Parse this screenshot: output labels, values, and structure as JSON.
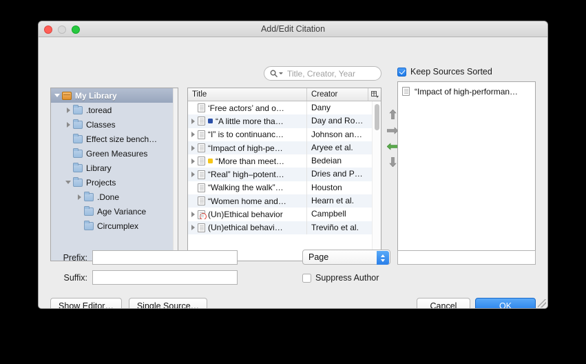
{
  "window": {
    "title": "Add/Edit Citation",
    "traffic_lights": [
      "close-button",
      "minimize-button",
      "zoom-button"
    ]
  },
  "search": {
    "placeholder": "Title, Creator, Year",
    "value": "",
    "icon": "search-icon"
  },
  "keep_sources_sorted": {
    "label": "Keep Sources Sorted",
    "checked": true
  },
  "collections": {
    "rows": [
      {
        "label": "My Library",
        "indent": 0,
        "icon": "library-icon",
        "twisty": "down",
        "selected": true
      },
      {
        "label": ".toread",
        "indent": 1,
        "icon": "folder-icon",
        "twisty": "right",
        "selected": false
      },
      {
        "label": "Classes",
        "indent": 1,
        "icon": "folder-icon",
        "twisty": "right",
        "selected": false
      },
      {
        "label": "Effect size bench…",
        "indent": 1,
        "icon": "folder-icon",
        "twisty": "none",
        "selected": false
      },
      {
        "label": "Green Measures",
        "indent": 1,
        "icon": "folder-icon",
        "twisty": "none",
        "selected": false
      },
      {
        "label": "Library",
        "indent": 1,
        "icon": "folder-icon",
        "twisty": "none",
        "selected": false
      },
      {
        "label": "Projects",
        "indent": 1,
        "icon": "folder-icon",
        "twisty": "down",
        "selected": false
      },
      {
        "label": ".Done",
        "indent": 2,
        "icon": "folder-icon",
        "twisty": "right",
        "selected": false
      },
      {
        "label": "Age Variance",
        "indent": 2,
        "icon": "folder-icon",
        "twisty": "none",
        "selected": false
      },
      {
        "label": "Circumplex",
        "indent": 2,
        "icon": "folder-icon",
        "twisty": "none",
        "selected": false
      }
    ]
  },
  "items": {
    "columns": {
      "title": "Title",
      "creator": "Creator",
      "options_icon": "column-options-icon"
    },
    "rows": [
      {
        "title": "‘Free actors’ and o…",
        "creator": "Dany",
        "twisty": false,
        "dot": "",
        "icon": "document-icon"
      },
      {
        "title": "“A little more tha…",
        "creator": "Day and Ro…",
        "twisty": true,
        "dot": "blue",
        "icon": "document-icon"
      },
      {
        "title": "“I” is to continuanc…",
        "creator": "Johnson an…",
        "twisty": true,
        "dot": "",
        "icon": "document-icon"
      },
      {
        "title": "“Impact of high-pe…",
        "creator": "Aryee et al.",
        "twisty": true,
        "dot": "",
        "icon": "document-icon"
      },
      {
        "title": "“More than meet…",
        "creator": "Bedeian",
        "twisty": true,
        "dot": "yellow",
        "icon": "document-icon"
      },
      {
        "title": "“Real” high–potent…",
        "creator": "Dries and P…",
        "twisty": true,
        "dot": "",
        "icon": "document-icon"
      },
      {
        "title": "“Walking the walk”…",
        "creator": "Houston",
        "twisty": false,
        "dot": "",
        "icon": "document-icon"
      },
      {
        "title": "“Women home and…",
        "creator": "Hearn et al.",
        "twisty": false,
        "dot": "",
        "icon": "document-icon"
      },
      {
        "title": "(Un)Ethical behavior",
        "creator": "Campbell",
        "twisty": true,
        "dot": "",
        "icon": "document-attachment-icon"
      },
      {
        "title": "(Un)ethical behavi…",
        "creator": "Treviño et al.",
        "twisty": true,
        "dot": "",
        "icon": "document-icon"
      }
    ]
  },
  "transfer_buttons": [
    {
      "name": "move-up-arrow",
      "glyph": "up"
    },
    {
      "name": "add-source-arrow",
      "glyph": "right"
    },
    {
      "name": "remove-source-arrow",
      "glyph": "left"
    },
    {
      "name": "move-down-arrow",
      "glyph": "down"
    }
  ],
  "selected_sources": {
    "rows": [
      {
        "title": "“Impact of high-performan…",
        "icon": "document-icon"
      }
    ]
  },
  "form": {
    "prefix_label": "Prefix:",
    "prefix_value": "",
    "suffix_label": "Suffix:",
    "suffix_value": "",
    "locator_label": "Page",
    "locator_value": "",
    "suppress_author_label": "Suppress Author",
    "suppress_author_checked": false
  },
  "buttons": {
    "show_editor": "Show Editor…",
    "single_source": "Single Source…",
    "cancel": "Cancel",
    "ok": "OK"
  },
  "colors": {
    "accent_blue": "#1f7ae9",
    "window_bg": "#ececec",
    "sidebar_bg": "#d6dce6",
    "row_alt": "#f0f4f9",
    "tag_blue": "#2a4fa8",
    "tag_yellow": "#f5c518",
    "traffic_close": "#ff5f57",
    "traffic_min": "#d9d9d9",
    "traffic_zoom": "#28c840"
  }
}
